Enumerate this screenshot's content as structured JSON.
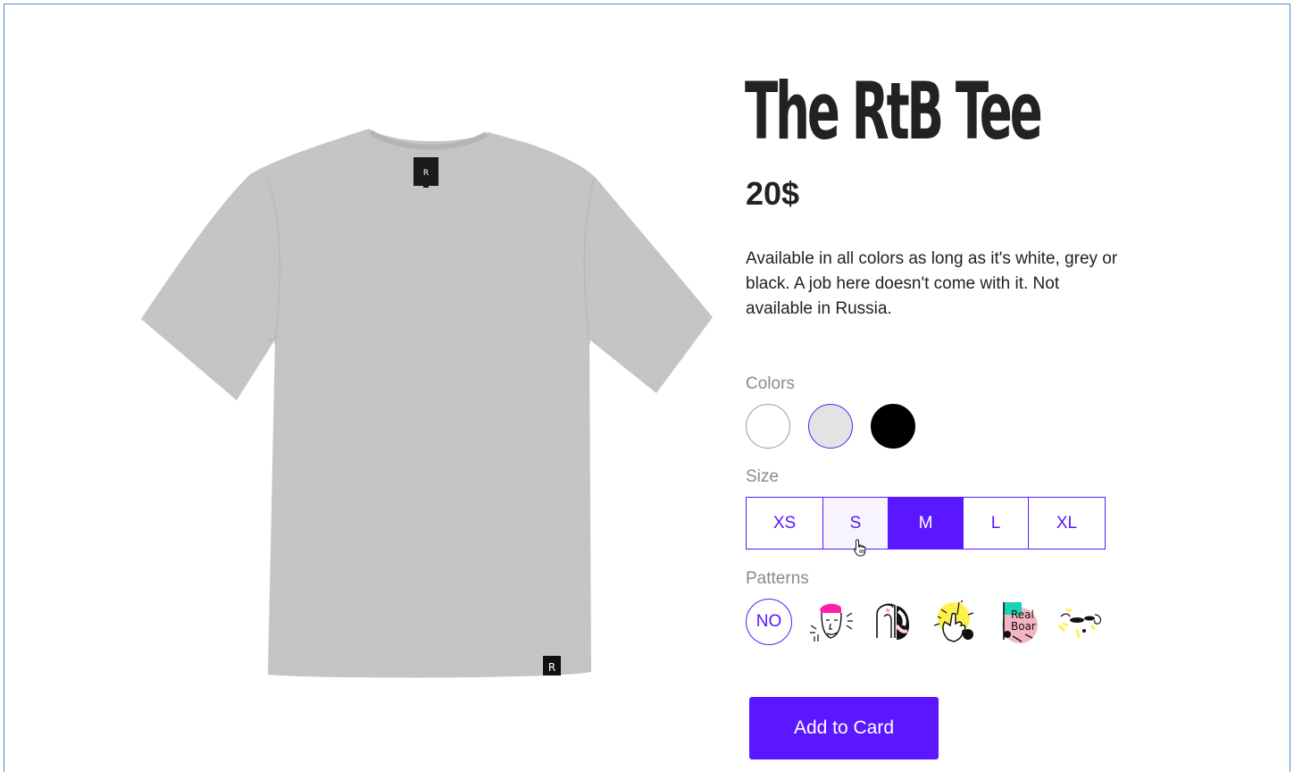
{
  "product": {
    "title": "The RtB Tee",
    "price": "20$",
    "description": "Available in all colors as long as it's white, grey or black. A job here doesn't come with it. Not available in Russia.",
    "neck_tag_letter": "R",
    "hem_tag_letter": "R"
  },
  "colors": {
    "label": "Colors",
    "options": [
      {
        "name": "white",
        "hex": "#ffffff",
        "selected": false
      },
      {
        "name": "grey",
        "hex": "#e3e3e3",
        "selected": true
      },
      {
        "name": "black",
        "hex": "#000000",
        "selected": false
      }
    ]
  },
  "size": {
    "label": "Size",
    "options": [
      "XS",
      "S",
      "M",
      "L",
      "XL"
    ],
    "selected": "M",
    "hovered": "S"
  },
  "patterns": {
    "label": "Patterns",
    "none_label": "NO",
    "items": [
      {
        "icon": "face-pattern-icon"
      },
      {
        "icon": "arch-pattern-icon"
      },
      {
        "icon": "hand-pattern-icon"
      },
      {
        "icon": "flag-pattern-icon",
        "text": "Real Boar"
      },
      {
        "icon": "shapes-pattern-icon"
      }
    ]
  },
  "cta": {
    "label": "Add to Card"
  },
  "accent": "#5b17ff"
}
